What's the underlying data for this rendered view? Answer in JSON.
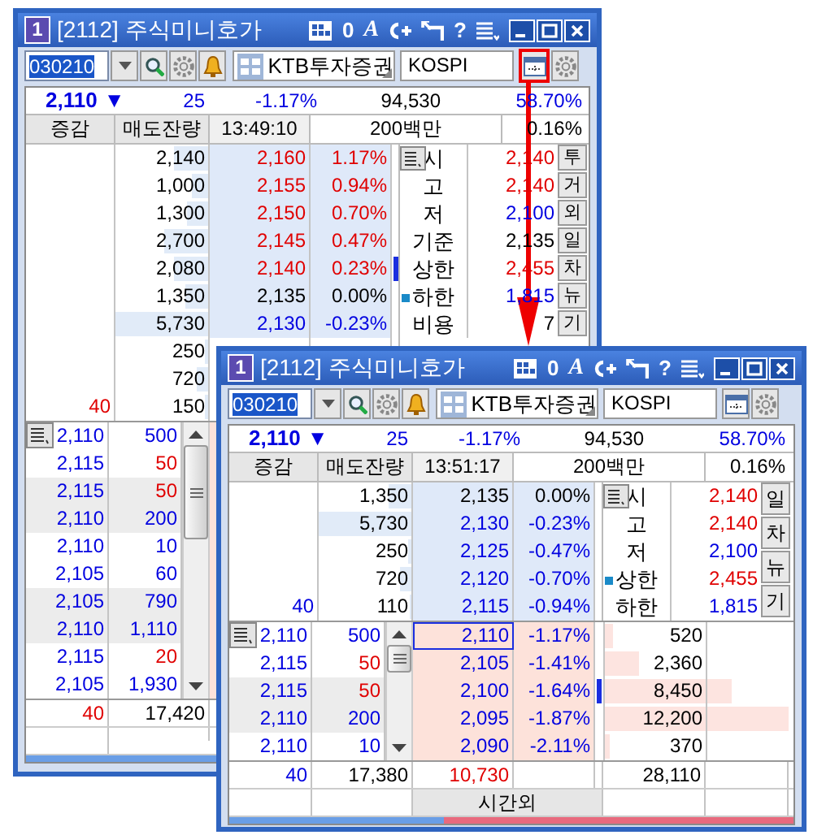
{
  "windows": [
    {
      "app_badge": "1",
      "title": "[2112] 주식미니호가",
      "tools": [
        {
          "kind": "grid"
        },
        {
          "kind": "glyph",
          "text": "0"
        },
        {
          "kind": "serif_glyph",
          "text": "A"
        },
        {
          "kind": "link"
        },
        {
          "kind": "pin"
        },
        {
          "kind": "glyph",
          "text": "?"
        },
        {
          "kind": "list"
        }
      ],
      "toolbar": {
        "code": "030210",
        "name": "KTB투자증권",
        "market": "KOSPI",
        "layout_button_highlighted": true
      },
      "summary": {
        "price": "2,110",
        "mark": "▼",
        "change": "25",
        "pct": "-1.17%",
        "volume": "94,530",
        "ratio": "58.70%"
      },
      "header": {
        "change_label": "증감",
        "qty_label": "매도잔량",
        "time": "13:49:10",
        "amount": "200백만",
        "ratio": "0.16%"
      },
      "sells": [
        {
          "qty": "2,140",
          "level": 0.37,
          "price": "2,160",
          "pct": "1.17%",
          "color": "#e00000",
          "marker": false
        },
        {
          "qty": "1,000",
          "level": 0.17,
          "price": "2,155",
          "pct": "0.94%",
          "color": "#e00000",
          "marker": false
        },
        {
          "qty": "1,300",
          "level": 0.23,
          "price": "2,150",
          "pct": "0.70%",
          "color": "#e00000",
          "marker": false
        },
        {
          "qty": "2,700",
          "level": 0.47,
          "price": "2,145",
          "pct": "0.47%",
          "color": "#e00000",
          "marker": false
        },
        {
          "qty": "2,080",
          "level": 0.36,
          "price": "2,140",
          "pct": "0.23%",
          "color": "#e00000",
          "marker": true
        },
        {
          "qty": "1,350",
          "level": 0.24,
          "price": "2,135",
          "pct": "0.00%",
          "color": "#000000",
          "marker": false
        },
        {
          "qty": "5,730",
          "level": 1,
          "price": "2,130",
          "pct": "-0.23%",
          "color": "#0000e0",
          "marker": false
        },
        {
          "qty": "250",
          "level": 0.04
        },
        {
          "qty": "720",
          "level": 0.13
        },
        {
          "change": {
            "text": "40",
            "color": "#e00000"
          },
          "qty": "150",
          "level": 0.03
        }
      ],
      "info": [
        {
          "label": "시",
          "value": "2,140",
          "color": "#e00000",
          "flag": false
        },
        {
          "label": "고",
          "value": "2,140",
          "color": "#e00000",
          "flag": false
        },
        {
          "label": "저",
          "value": "2,100",
          "color": "#0000e0",
          "flag": false
        },
        {
          "label": "기준",
          "value": "2,135",
          "color": "#000000",
          "flag": false
        },
        {
          "label": "상한",
          "value": "2,455",
          "color": "#e00000",
          "flag": false
        },
        {
          "label": "하한",
          "value": "1,815",
          "color": "#0000e0",
          "flag": true
        },
        {
          "label": "비용",
          "value": "7",
          "color": "#000000",
          "flag": false
        }
      ],
      "side_buttons": [
        "투",
        "거",
        "외",
        "일",
        "차",
        "뉴",
        "기"
      ],
      "trades": [
        {
          "price": "2,110",
          "qty": "500",
          "color": "#0000e0"
        },
        {
          "price": "2,115",
          "qty": "50",
          "color": "#e00000"
        },
        {
          "price": "2,115",
          "qty": "50",
          "color": "#e00000"
        },
        {
          "price": "2,110",
          "qty": "200",
          "color": "#0000e0"
        },
        {
          "price": "2,110",
          "qty": "10",
          "color": "#0000e0"
        },
        {
          "price": "2,105",
          "qty": "60",
          "color": "#0000e0"
        },
        {
          "price": "2,105",
          "qty": "790",
          "color": "#0000e0"
        },
        {
          "price": "2,110",
          "qty": "1,110",
          "color": "#0000e0"
        },
        {
          "price": "2,115",
          "qty": "20",
          "color": "#e00000"
        },
        {
          "price": "2,105",
          "qty": "1,930",
          "color": "#0000e0"
        }
      ],
      "totals": {
        "change": {
          "text": "40",
          "color": "#e00000"
        },
        "sell_total": "17,420"
      },
      "ratio_bar": {
        "level": 0.45
      }
    },
    {
      "app_badge": "1",
      "title": "[2112] 주식미니호가",
      "tools": [
        {
          "kind": "grid"
        },
        {
          "kind": "glyph",
          "text": "0"
        },
        {
          "kind": "serif_glyph",
          "text": "A"
        },
        {
          "kind": "link"
        },
        {
          "kind": "pin"
        },
        {
          "kind": "glyph",
          "text": "?"
        },
        {
          "kind": "list"
        }
      ],
      "toolbar": {
        "code": "030210",
        "name": "KTB투자증권",
        "market": "KOSPI",
        "layout_button_highlighted": false
      },
      "summary": {
        "price": "2,110",
        "mark": "▼",
        "change": "25",
        "pct": "-1.17%",
        "volume": "94,530",
        "ratio": "58.70%"
      },
      "header": {
        "change_label": "증감",
        "qty_label": "매도잔량",
        "time": "13:51:17",
        "amount": "200백만",
        "ratio": "0.16%"
      },
      "sells": [
        {
          "qty": "1,350",
          "level": 0.24,
          "price": "2,135",
          "pct": "0.00%",
          "color": "#000000",
          "marker": false
        },
        {
          "qty": "5,730",
          "level": 1,
          "price": "2,130",
          "pct": "-0.23%",
          "color": "#0000e0",
          "marker": false
        },
        {
          "qty": "250",
          "level": 0.04,
          "price": "2,125",
          "pct": "-0.47%",
          "color": "#0000e0",
          "marker": false
        },
        {
          "qty": "720",
          "level": 0.13,
          "price": "2,120",
          "pct": "-0.70%",
          "color": "#0000e0",
          "marker": false
        },
        {
          "change": {
            "text": "40",
            "color": "#0000e0"
          },
          "qty": "110",
          "level": 0.02,
          "price": "2,115",
          "pct": "-0.94%",
          "color": "#0000e0",
          "marker": false
        }
      ],
      "info": [
        {
          "label": "시",
          "value": "2,140",
          "color": "#e00000",
          "flag": false
        },
        {
          "label": "고",
          "value": "2,140",
          "color": "#e00000",
          "flag": false
        },
        {
          "label": "저",
          "value": "2,100",
          "color": "#0000e0",
          "flag": false
        },
        {
          "label": "상한",
          "value": "2,455",
          "color": "#e00000",
          "flag": true
        },
        {
          "label": "하한",
          "value": "1,815",
          "color": "#0000e0",
          "flag": false
        }
      ],
      "side_buttons": [
        "일",
        "차",
        "뉴",
        "기"
      ],
      "trades": [
        {
          "price": "2,110",
          "qty": "500",
          "color": "#0000e0"
        },
        {
          "price": "2,115",
          "qty": "50",
          "color": "#e00000"
        },
        {
          "price": "2,115",
          "qty": "50",
          "color": "#e00000"
        },
        {
          "price": "2,110",
          "qty": "200",
          "color": "#0000e0"
        },
        {
          "price": "2,110",
          "qty": "10",
          "color": "#0000e0"
        }
      ],
      "bids": [
        {
          "price": "2,110",
          "pct": "-1.17%",
          "qty": "520",
          "level": 0.04,
          "current": true,
          "marker": false
        },
        {
          "price": "2,105",
          "pct": "-1.41%",
          "qty": "2,360",
          "level": 0.19,
          "current": false,
          "marker": false
        },
        {
          "price": "2,100",
          "pct": "-1.64%",
          "qty": "8,450",
          "level": 0.69,
          "current": false,
          "marker": true
        },
        {
          "price": "2,095",
          "pct": "-1.87%",
          "qty": "12,200",
          "level": 1,
          "current": false,
          "marker": false
        },
        {
          "price": "2,090",
          "pct": "-2.11%",
          "qty": "370",
          "level": 0.03,
          "current": false,
          "marker": false
        }
      ],
      "totals": {
        "change": {
          "text": "40",
          "color": "#0000e0"
        },
        "sell_total": "17,380",
        "net": {
          "text": "10,730",
          "color": "#e00000"
        },
        "buy_total": "28,110"
      },
      "after_hours_label": "시간외",
      "ratio_bar": {
        "level": 0.38
      }
    }
  ]
}
